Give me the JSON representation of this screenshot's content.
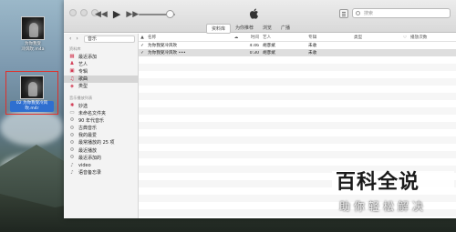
{
  "desktop": {
    "icons": [
      {
        "label_line1": "为你我受",
        "label_line2": "冷风吹.m4a"
      },
      {
        "label_line1": "02 为你我受冷风",
        "label_line2": "吹.m4r"
      }
    ]
  },
  "window": {
    "toolbar": {
      "back_icon": "rewind-icon",
      "play_icon": "play-icon",
      "forward_icon": "fast-forward-icon",
      "search_placeholder": "搜索"
    },
    "tabs": [
      "资料库",
      "为你推荐",
      "浏览",
      "广播"
    ],
    "sidebar": {
      "library_select": "音乐",
      "section_library": "资料库",
      "library_items": [
        {
          "label": "最近添加",
          "icon": "recent-icon"
        },
        {
          "label": "艺人",
          "icon": "artist-icon"
        },
        {
          "label": "专辑",
          "icon": "album-icon"
        },
        {
          "label": "歌曲",
          "icon": "song-icon"
        },
        {
          "label": "类型",
          "icon": "genre-icon"
        }
      ],
      "section_playlists": "音乐播放列表",
      "playlist_items": [
        {
          "label": "妙选",
          "icon": "genius-icon"
        },
        {
          "label": "未命名文件夹",
          "icon": "folder-icon"
        },
        {
          "label": "90 年代音乐",
          "icon": "gear-icon"
        },
        {
          "label": "古典音乐",
          "icon": "gear-icon"
        },
        {
          "label": "我的最爱",
          "icon": "gear-icon"
        },
        {
          "label": "最常播放的 25 项",
          "icon": "gear-icon"
        },
        {
          "label": "最近播放",
          "icon": "gear-icon"
        },
        {
          "label": "最近添加的",
          "icon": "gear-icon"
        },
        {
          "label": "video",
          "icon": "playlist-icon"
        },
        {
          "label": "语音备忘录",
          "icon": "playlist-icon"
        }
      ]
    },
    "columns": {
      "name": "名称",
      "time": "时间",
      "artist": "艺人",
      "album": "专辑",
      "genre": "类型",
      "plays": "播放次数"
    },
    "songs": [
      {
        "check": "✓",
        "name": "为你我受冷风吹",
        "time": "4:46",
        "artist": "胡彦斌",
        "album": "未收",
        "genre": ""
      },
      {
        "check": "✓",
        "name": "为你我受冷风吹 •••",
        "time": "0:30",
        "artist": "胡彦斌",
        "album": "未收",
        "genre": ""
      }
    ]
  },
  "watermark": {
    "title": "百科全说",
    "subtitle": "助你轻松解决"
  }
}
